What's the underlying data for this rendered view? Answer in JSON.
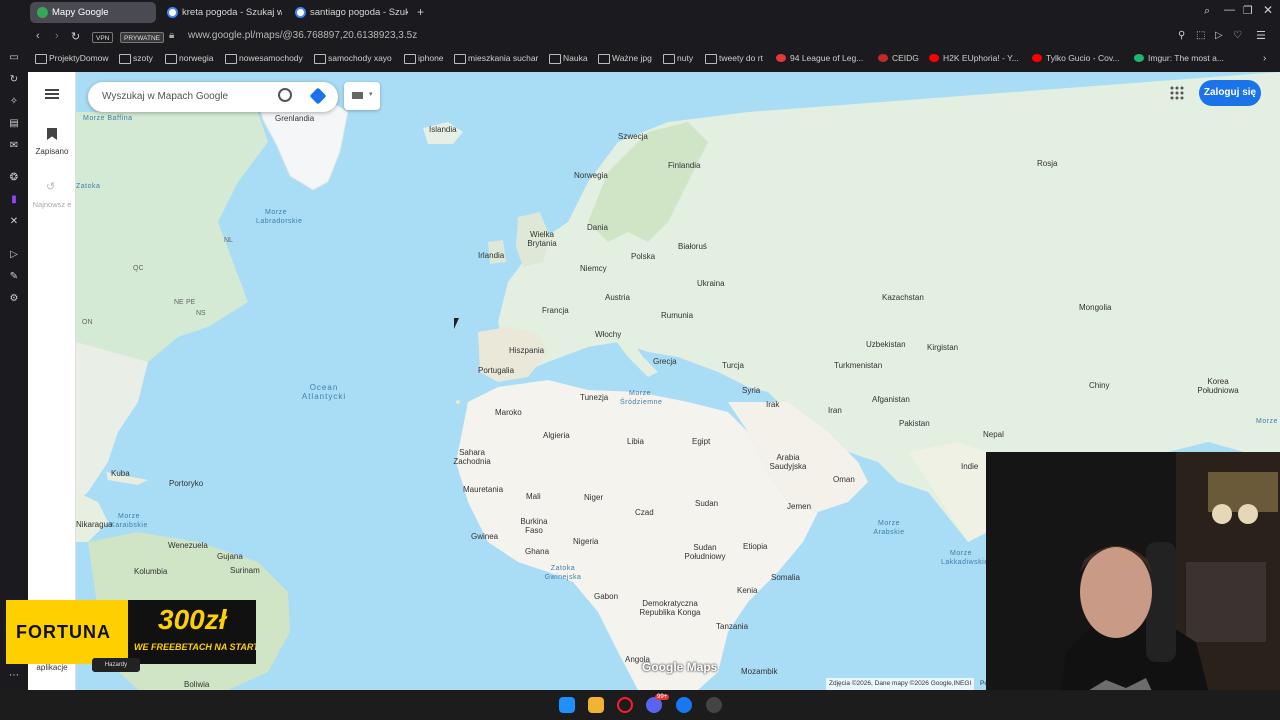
{
  "browser": {
    "tabs": [
      {
        "label": "Mapy Google",
        "active": true
      },
      {
        "label": "kreta pogoda - Szukaj w G",
        "active": false
      },
      {
        "label": "santiago pogoda - Szukaj",
        "active": false
      }
    ],
    "new_tab_label": "+",
    "address": {
      "vpn_badge": "VPN",
      "private_badge": "PRYWATNE",
      "url": "www.google.pl/maps/@36.768897,20.6138923,3.5z"
    },
    "bookmarks": [
      {
        "label": "ProjektyDomow",
        "type": "folder"
      },
      {
        "label": "szoty",
        "type": "folder"
      },
      {
        "label": "norwegia",
        "type": "folder"
      },
      {
        "label": "nowesamochody",
        "type": "folder"
      },
      {
        "label": "samochody xayo",
        "type": "folder"
      },
      {
        "label": "iphone",
        "type": "folder"
      },
      {
        "label": "mieszkania suchar",
        "type": "folder"
      },
      {
        "label": "Nauka",
        "type": "folder"
      },
      {
        "label": "Ważne jpg",
        "type": "folder"
      },
      {
        "label": "nuty",
        "type": "folder"
      },
      {
        "label": "tweety do rt",
        "type": "folder"
      },
      {
        "label": "94 League of Leg...",
        "type": "site",
        "color": "#e53935"
      },
      {
        "label": "CEIDG",
        "type": "site",
        "color": "#c62828"
      },
      {
        "label": "H2K EUphoria! - Y...",
        "type": "site",
        "color": "#ff0000"
      },
      {
        "label": "Tylko Gucio - Cov...",
        "type": "site",
        "color": "#ff0000"
      },
      {
        "label": "Imgur: The most a...",
        "type": "site",
        "color": "#1bb76e"
      }
    ]
  },
  "maps": {
    "search_placeholder": "Wyszukaj w Mapach Google",
    "saved_label": "Zapisano",
    "recent_label": "Najnowsz e",
    "login_label": "Zaloguj się",
    "apps_label": "aplikacje",
    "logo": "Google Maps",
    "attribution": "Zdjęcia ©2026, Dane mapy ©2026 Google,INEGI",
    "attribution_tail": "Po",
    "labels": {
      "greenland": "Grenlandia",
      "iceland": "Islandia",
      "sweden": "Szwecja",
      "finland": "Finlandia",
      "norway": "Norwegia",
      "russia": "Rosja",
      "labrador": "Morze Labradorskie",
      "uk": "Wielka Brytania",
      "denmark": "Dania",
      "ireland": "Irlandia",
      "belarus": "Białoruś",
      "poland": "Polska",
      "germany": "Niemcy",
      "ukraine": "Ukraina",
      "kazakhstan": "Kazachstan",
      "mongolia": "Mongolia",
      "austria": "Austria",
      "france": "Francja",
      "romania": "Rumunia",
      "italy": "Włochy",
      "uzbekistan": "Uzbekistan",
      "kyrgyzstan": "Kirgistan",
      "spain": "Hiszpania",
      "portugal": "Portugalia",
      "greece": "Grecja",
      "turkey": "Turcja",
      "turkmenistan": "Turkmenistan",
      "atlantic": "Ocean Atlantycki",
      "china": "Chiny",
      "korea": "Korea Południowa",
      "yellow_sea": "Morze Żółte",
      "syria": "Syria",
      "tunisia": "Tunezja",
      "morocco": "Maroko",
      "mediterranean": "Morze Śródziemne",
      "iraq": "Irak",
      "iran": "Iran",
      "afghanistan": "Afganistan",
      "pakistan": "Pakistan",
      "algeria": "Algieria",
      "libya": "Libia",
      "egypt": "Egipt",
      "nepal": "Nepal",
      "saudi": "Arabia Saudyjska",
      "india": "Indie",
      "western_sahara": "Sahara Zachodnia",
      "cuba": "Kuba",
      "puerto_rico": "Portoryko",
      "oman": "Oman",
      "mauritania": "Mauretania",
      "mali": "Mali",
      "niger": "Niger",
      "chad": "Czad",
      "sudan": "Sudan",
      "yemen": "Jemen",
      "caribbean": "Morze Karaibskie",
      "arabian_sea": "Morze Arabskie",
      "nicaragua": "Nikaragua",
      "burkina": "Burkina Faso",
      "guinea": "Gwinea",
      "ghana": "Ghana",
      "nigeria": "Nigeria",
      "south_sudan": "Sudan Południowy",
      "ethiopia": "Etiopia",
      "venezuela": "Wenezuela",
      "guyana": "Gujana",
      "suriname": "Surinam",
      "gulf_guinea": "Zatoka Gwinejska",
      "laccadive": "Morze Lakkadiwskie",
      "colombia": "Kolumbia",
      "somalia": "Somalia",
      "gabon": "Gabon",
      "kenya": "Kenia",
      "drc": "Demokratyczna Republika Konga",
      "tanzania": "Tanzania",
      "angola": "Angola",
      "mozambique": "Mozambik",
      "bolivia": "Boliwia",
      "hudson": "Zatoka Hudsona",
      "baffin": "Morze Baffina",
      "zatoka": "Zatoka",
      "ns": "NS",
      "ne": "NE",
      "pe": "PE",
      "nl": "NL",
      "qc": "QC",
      "on": "ON"
    }
  },
  "overlay": {
    "fortuna_brand": "FORTUNA",
    "fortuna_amount": "300zł",
    "fortuna_tagline": "WE FREEBETACH NA START",
    "fortuna_badge": "Hazardy"
  },
  "taskbar": {
    "notification_count": "99+"
  }
}
